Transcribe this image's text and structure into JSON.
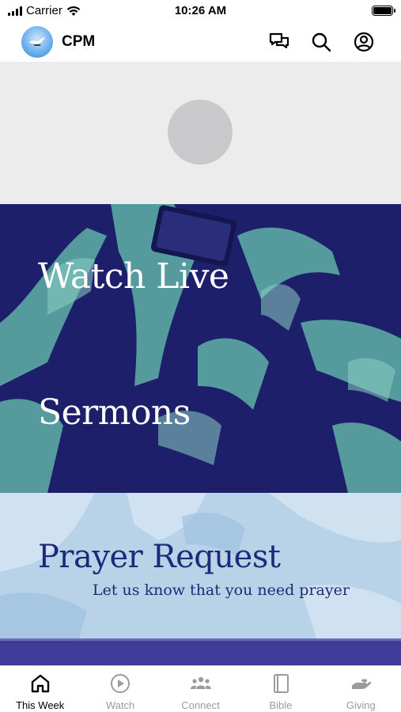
{
  "status_bar": {
    "carrier": "Carrier",
    "time": "10:26 AM"
  },
  "header": {
    "title": "CPM",
    "icons": [
      "chat-icon",
      "search-icon",
      "profile-icon"
    ]
  },
  "features": {
    "watch_live": "Watch Live",
    "sermons": "Sermons"
  },
  "prayer": {
    "title": "Prayer Request",
    "subtitle": "Let us know that you need prayer"
  },
  "tabs": [
    {
      "label": "This Week",
      "icon": "home-icon",
      "active": true
    },
    {
      "label": "Watch",
      "icon": "play-icon",
      "active": false
    },
    {
      "label": "Connect",
      "icon": "people-icon",
      "active": false
    },
    {
      "label": "Bible",
      "icon": "book-icon",
      "active": false
    },
    {
      "label": "Giving",
      "icon": "giving-hand-icon",
      "active": false
    }
  ],
  "colors": {
    "feature_bg": "#1d1f6b",
    "feature_tint": "#5fb0a6",
    "prayer_text": "#1e2a78",
    "tab_active": "#000000",
    "tab_inactive": "#9b9b9b"
  }
}
